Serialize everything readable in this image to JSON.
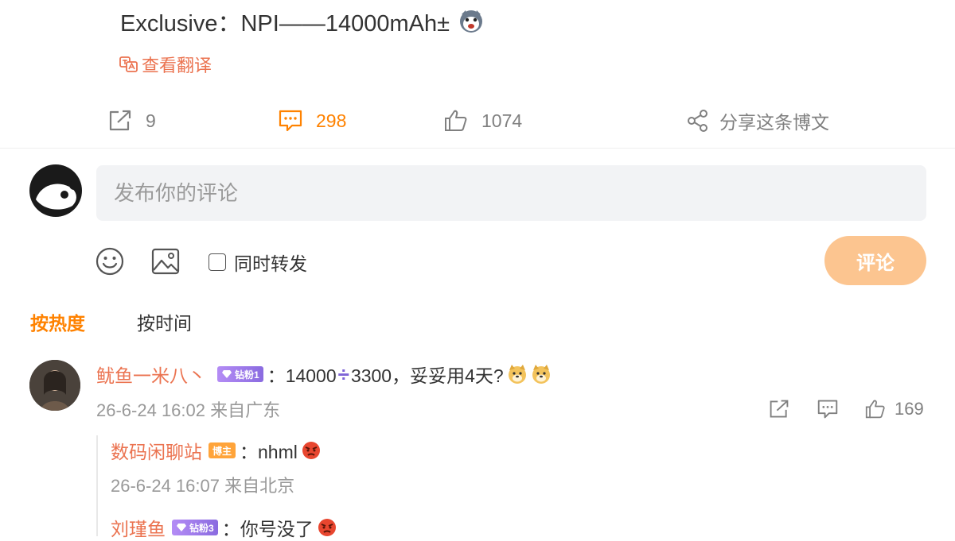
{
  "post": {
    "text": "Exclusive：NPI——14000mAh±",
    "emoji": "husky-face-emoji",
    "translate_label": "查看翻译"
  },
  "actions": {
    "repost_count": "9",
    "comment_count": "298",
    "like_count": "1074",
    "share_label": "分享这条博文"
  },
  "composer": {
    "placeholder": "发布你的评论",
    "repost_label": "同时转发",
    "repost_checked": false,
    "submit_label": "评论"
  },
  "sort": {
    "tabs": [
      {
        "label": "按热度",
        "active": true
      },
      {
        "label": "按时间",
        "active": false
      }
    ]
  },
  "comments": [
    {
      "user": "鱿鱼一米八丶",
      "badge": "钻粉1",
      "text_before": "：14000",
      "divide": "÷",
      "text_after": "3300，妥妥用4天?",
      "emojis": [
        "doge-emoji",
        "doge-emoji"
      ],
      "time": "26-6-24 16:02 来自广东",
      "like_count": "169"
    }
  ],
  "replies": [
    {
      "user": "数码闲聊站",
      "badge": "博主",
      "text": "：nhml",
      "emoji": "angry-face-emoji",
      "time": "26-6-24 16:07 来自北京"
    },
    {
      "user": "刘瑾鱼",
      "badge": "钻粉3",
      "text": "：你号没了",
      "emoji": "angry-face-emoji"
    }
  ],
  "colors": {
    "accent": "#ff8200",
    "username": "#eb7350",
    "submit_bg": "#fcc590",
    "input_bg": "#f2f3f5",
    "meta": "#999999"
  }
}
